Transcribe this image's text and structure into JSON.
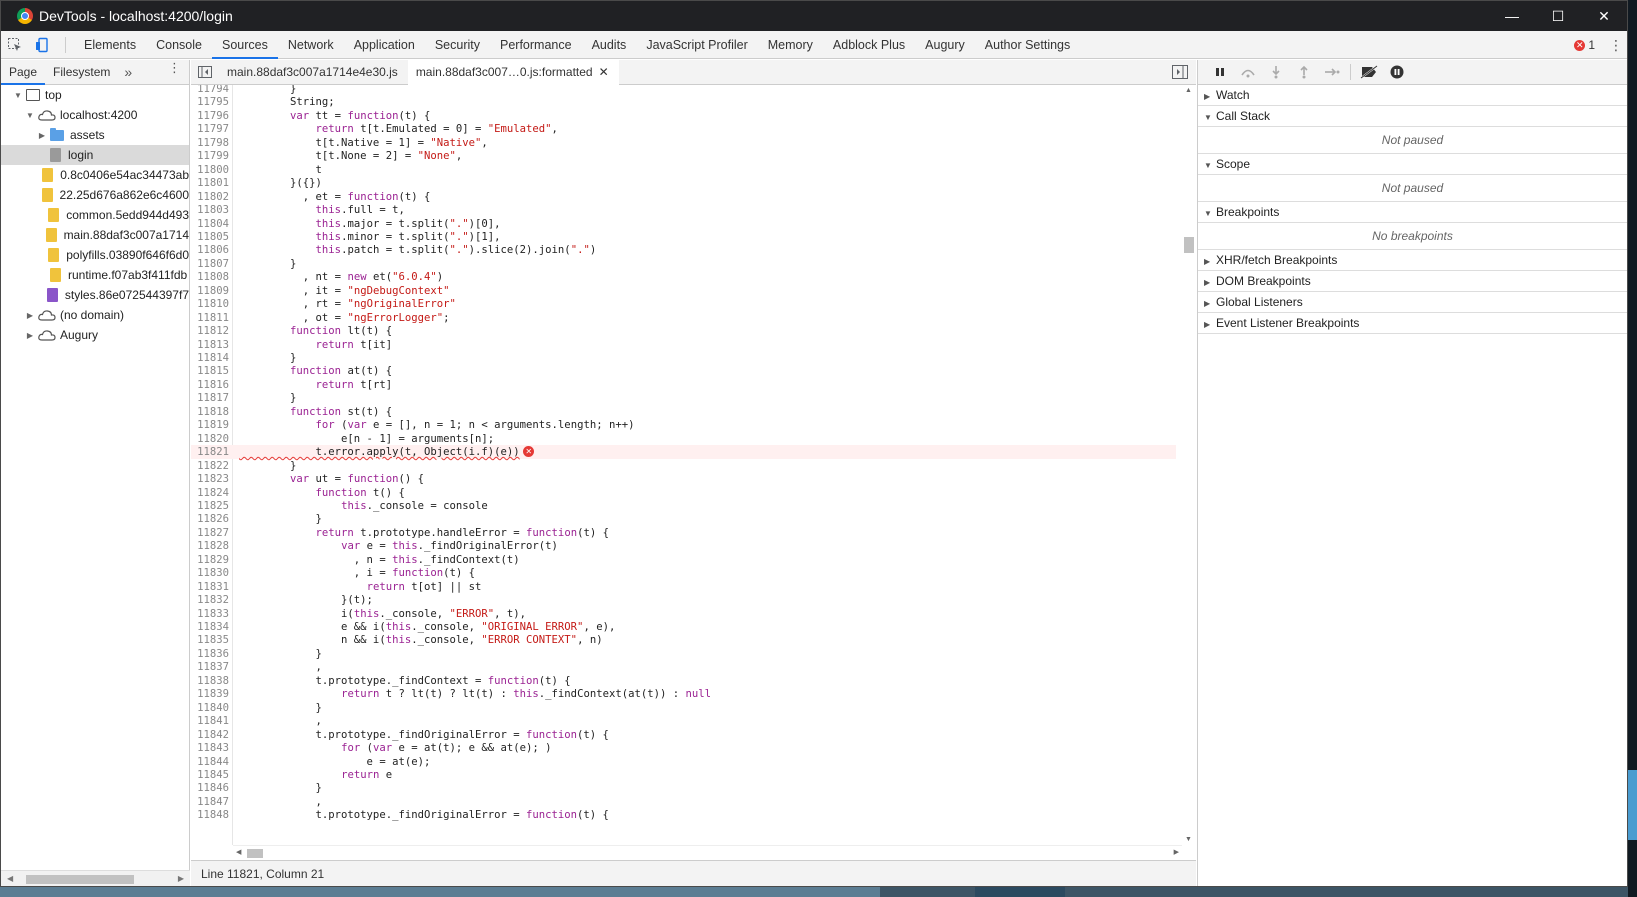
{
  "window": {
    "title": "DevTools - localhost:4200/login",
    "minimize": "—",
    "maximize": "☐",
    "close": "✕"
  },
  "toolbar": {
    "tabs": [
      "Elements",
      "Console",
      "Sources",
      "Network",
      "Application",
      "Security",
      "Performance",
      "Audits",
      "JavaScript Profiler",
      "Memory",
      "Adblock Plus",
      "Augury",
      "Author Settings"
    ],
    "active_tab": "Sources",
    "error_count": "1"
  },
  "navigator": {
    "tabs": [
      "Page",
      "Filesystem"
    ],
    "more": "»",
    "tree": [
      {
        "label": "top",
        "indent": 0,
        "icon": "frame-icon",
        "tri": "▼"
      },
      {
        "label": "localhost:4200",
        "indent": 1,
        "icon": "cloud-icon",
        "tri": "▼"
      },
      {
        "label": "assets",
        "indent": 2,
        "icon": "folder-icon",
        "tri": "▶"
      },
      {
        "label": "login",
        "indent": 2,
        "icon": "doc-file-icon",
        "tri": "",
        "selected": true
      },
      {
        "label": "0.8c0406e54ac34473ab",
        "indent": 2,
        "icon": "js-file-icon",
        "tri": ""
      },
      {
        "label": "22.25d676a862e6c4600",
        "indent": 2,
        "icon": "js-file-icon",
        "tri": ""
      },
      {
        "label": "common.5edd944d493",
        "indent": 2,
        "icon": "js-file-icon",
        "tri": ""
      },
      {
        "label": "main.88daf3c007a1714",
        "indent": 2,
        "icon": "js-file-icon",
        "tri": ""
      },
      {
        "label": "polyfills.03890f646f6d0",
        "indent": 2,
        "icon": "js-file-icon",
        "tri": ""
      },
      {
        "label": "runtime.f07ab3f411fdb",
        "indent": 2,
        "icon": "js-file-icon",
        "tri": ""
      },
      {
        "label": "styles.86e072544397f7",
        "indent": 2,
        "icon": "css-file-icon",
        "tri": ""
      },
      {
        "label": "(no domain)",
        "indent": 1,
        "icon": "cloud-icon",
        "tri": "▶"
      },
      {
        "label": "Augury",
        "indent": 1,
        "icon": "cloud-icon",
        "tri": "▶"
      }
    ]
  },
  "editor": {
    "tabs": [
      {
        "label": "main.88daf3c007a1714e4e30.js",
        "active": false
      },
      {
        "label": "main.88daf3c007…0.js:formatted",
        "active": true,
        "closable": "✕"
      }
    ],
    "status": "Line 11821, Column 21",
    "lines": [
      {
        "n": "11794",
        "t": "        }"
      },
      {
        "n": "11795",
        "t": "        String;"
      },
      {
        "n": "11796",
        "t": "        var tt = function(t) {"
      },
      {
        "n": "11797",
        "t": "            return t[t.Emulated = 0] = \"Emulated\","
      },
      {
        "n": "11798",
        "t": "            t[t.Native = 1] = \"Native\","
      },
      {
        "n": "11799",
        "t": "            t[t.None = 2] = \"None\","
      },
      {
        "n": "11800",
        "t": "            t"
      },
      {
        "n": "11801",
        "t": "        }({})"
      },
      {
        "n": "11802",
        "t": "          , et = function(t) {"
      },
      {
        "n": "11803",
        "t": "            this.full = t,"
      },
      {
        "n": "11804",
        "t": "            this.major = t.split(\".\")[0],"
      },
      {
        "n": "11805",
        "t": "            this.minor = t.split(\".\")[1],"
      },
      {
        "n": "11806",
        "t": "            this.patch = t.split(\".\").slice(2).join(\".\")"
      },
      {
        "n": "11807",
        "t": "        }"
      },
      {
        "n": "11808",
        "t": "          , nt = new et(\"6.0.4\")"
      },
      {
        "n": "11809",
        "t": "          , it = \"ngDebugContext\""
      },
      {
        "n": "11810",
        "t": "          , rt = \"ngOriginalError\""
      },
      {
        "n": "11811",
        "t": "          , ot = \"ngErrorLogger\";"
      },
      {
        "n": "11812",
        "t": "        function lt(t) {"
      },
      {
        "n": "11813",
        "t": "            return t[it]"
      },
      {
        "n": "11814",
        "t": "        }"
      },
      {
        "n": "11815",
        "t": "        function at(t) {"
      },
      {
        "n": "11816",
        "t": "            return t[rt]"
      },
      {
        "n": "11817",
        "t": "        }"
      },
      {
        "n": "11818",
        "t": "        function st(t) {"
      },
      {
        "n": "11819",
        "t": "            for (var e = [], n = 1; n < arguments.length; n++)"
      },
      {
        "n": "11820",
        "t": "                e[n - 1] = arguments[n];"
      },
      {
        "n": "11821",
        "t": "            t.error.apply(t, Object(i.f)(e))",
        "error": true
      },
      {
        "n": "11822",
        "t": "        }"
      },
      {
        "n": "11823",
        "t": "        var ut = function() {"
      },
      {
        "n": "11824",
        "t": "            function t() {"
      },
      {
        "n": "11825",
        "t": "                this._console = console"
      },
      {
        "n": "11826",
        "t": "            }"
      },
      {
        "n": "11827",
        "t": "            return t.prototype.handleError = function(t) {"
      },
      {
        "n": "11828",
        "t": "                var e = this._findOriginalError(t)"
      },
      {
        "n": "11829",
        "t": "                  , n = this._findContext(t)"
      },
      {
        "n": "11830",
        "t": "                  , i = function(t) {"
      },
      {
        "n": "11831",
        "t": "                    return t[ot] || st"
      },
      {
        "n": "11832",
        "t": "                }(t);"
      },
      {
        "n": "11833",
        "t": "                i(this._console, \"ERROR\", t),"
      },
      {
        "n": "11834",
        "t": "                e && i(this._console, \"ORIGINAL ERROR\", e),"
      },
      {
        "n": "11835",
        "t": "                n && i(this._console, \"ERROR CONTEXT\", n)"
      },
      {
        "n": "11836",
        "t": "            }"
      },
      {
        "n": "11837",
        "t": "            ,"
      },
      {
        "n": "11838",
        "t": "            t.prototype._findContext = function(t) {"
      },
      {
        "n": "11839",
        "t": "                return t ? lt(t) ? lt(t) : this._findContext(at(t)) : null"
      },
      {
        "n": "11840",
        "t": "            }"
      },
      {
        "n": "11841",
        "t": "            ,"
      },
      {
        "n": "11842",
        "t": "            t.prototype._findOriginalError = function(t) {"
      },
      {
        "n": "11843",
        "t": "                for (var e = at(t); e && at(e); )"
      },
      {
        "n": "11844",
        "t": "                    e = at(e);"
      },
      {
        "n": "11845",
        "t": "                return e"
      },
      {
        "n": "11846",
        "t": "            }"
      },
      {
        "n": "11847",
        "t": "            ,"
      },
      {
        "n": "11848",
        "t": "            t.prototype._findOriginalError = function(t) {"
      }
    ]
  },
  "debugger": {
    "panes": [
      {
        "title": "Watch",
        "open": false,
        "body": ""
      },
      {
        "title": "Call Stack",
        "open": true,
        "body": "Not paused"
      },
      {
        "title": "Scope",
        "open": true,
        "body": "Not paused"
      },
      {
        "title": "Breakpoints",
        "open": true,
        "body": "No breakpoints"
      },
      {
        "title": "XHR/fetch Breakpoints",
        "open": false,
        "body": ""
      },
      {
        "title": "DOM Breakpoints",
        "open": false,
        "body": ""
      },
      {
        "title": "Global Listeners",
        "open": false,
        "body": ""
      },
      {
        "title": "Event Listener Breakpoints",
        "open": false,
        "body": ""
      }
    ]
  },
  "colors": {
    "accent": "#1a73e8",
    "error": "#e53935",
    "keyword": "#9b2393",
    "string": "#c41a16"
  }
}
